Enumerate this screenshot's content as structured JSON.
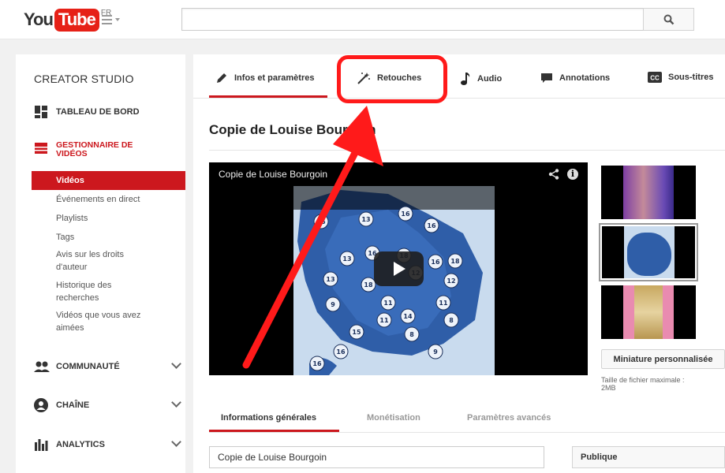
{
  "header": {
    "logo_you": "You",
    "logo_tube": "Tube",
    "logo_country": "FR",
    "search_placeholder": "",
    "icons": [
      "guide-menu-icon",
      "search-icon"
    ]
  },
  "sidebar": {
    "title": "CREATOR STUDIO",
    "sections": [
      {
        "label": "TABLEAU DE BORD",
        "icon": "dashboard-icon"
      },
      {
        "label": "GESTIONNAIRE DE VIDÉOS",
        "icon": "video-manager-icon",
        "color": "#cc181e"
      },
      {
        "label": "COMMUNAUTÉ",
        "icon": "community-icon"
      },
      {
        "label": "CHAÎNE",
        "icon": "channel-icon"
      },
      {
        "label": "ANALYTICS",
        "icon": "analytics-icon"
      }
    ],
    "video_manager_line1": "GESTIONNAIRE DE",
    "video_manager_line2": "VIDÉOS",
    "sub_items": [
      {
        "label": "Vidéos",
        "active": true
      },
      {
        "label": "Événements en direct"
      },
      {
        "label": "Playlists"
      },
      {
        "label": "Tags"
      },
      {
        "label": "Avis sur les droits d'auteur",
        "line1": "Avis sur les droits",
        "line2": "d'auteur"
      },
      {
        "label": "Historique des recherches",
        "line1": "Historique des",
        "line2": "recherches"
      },
      {
        "label": "Vidéos que vous avez aimées",
        "line1": "Vidéos que vous avez",
        "line2": "aimées"
      }
    ]
  },
  "tabs": [
    {
      "label": "Infos et paramètres",
      "icon": "pencil-icon",
      "active": true
    },
    {
      "label": "Retouches",
      "icon": "magic-wand-icon"
    },
    {
      "label": "Audio",
      "icon": "music-note-icon"
    },
    {
      "label": "Annotations",
      "icon": "speech-bubble-icon"
    },
    {
      "label": "Sous-titres",
      "icon": "cc-icon"
    }
  ],
  "video": {
    "title": "Copie de Louise Bourgoin",
    "player_title": "Copie de Louise Bourgoin",
    "map_numbers": [
      "16",
      "13",
      "16",
      "16",
      "13",
      "16",
      "18",
      "13",
      "18",
      "12",
      "16",
      "18",
      "11",
      "12",
      "11",
      "14",
      "8",
      "8",
      "11",
      "15",
      "9",
      "16",
      "9",
      "16"
    ],
    "custom_thumbnail_button": "Miniature personnalisée",
    "max_file_size_line1": "Taille de fichier maximale :",
    "max_file_size_line2": "2MB"
  },
  "subtabs": [
    {
      "label": "Informations générales",
      "active": true
    },
    {
      "label": "Monétisation"
    },
    {
      "label": "Paramètres avancés"
    }
  ],
  "form": {
    "title_value": "Copie de Louise Bourgoin",
    "privacy_value": "Publique"
  },
  "colors": {
    "accent": "#cc181e",
    "annotation": "#ff1a1a",
    "map_blue": "#2f5ea8"
  }
}
